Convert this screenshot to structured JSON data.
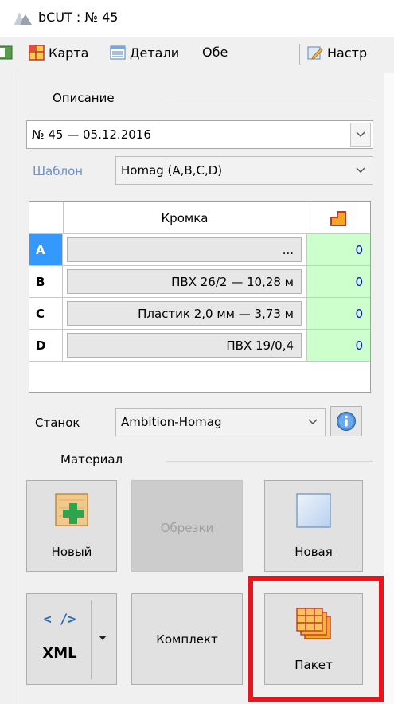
{
  "window": {
    "title": "bCUT : № 45"
  },
  "toolbar": {
    "karta_label": "Карта",
    "detali_label": "Детали",
    "obe_label": "Обе",
    "nastr_label": "Настр"
  },
  "description": {
    "group_label": "Описание",
    "value": "№ 45 — 05.12.2016"
  },
  "template": {
    "label": "Шаблон",
    "value": "Homag (A,B,C,D)"
  },
  "edge_table": {
    "column_header": "Кромка",
    "rows": [
      {
        "key": "A",
        "edge": "...",
        "value": "0"
      },
      {
        "key": "B",
        "edge": "ПВХ 26/2 — 10,28 м",
        "value": "0"
      },
      {
        "key": "C",
        "edge": "Пластик 2,0 мм — 3,73 м",
        "value": "0"
      },
      {
        "key": "D",
        "edge": "ПВХ 19/0,4",
        "value": "0"
      }
    ]
  },
  "machine": {
    "label": "Станок",
    "value": "Ambition-Homag"
  },
  "material": {
    "group_label": "Материал",
    "new_button": "Новый",
    "offcuts_button": "Обрезки",
    "new_sheet_button": "Новая"
  },
  "export": {
    "xml_top": "< />",
    "xml_bottom": "XML",
    "kit_button": "Комплект",
    "package_button": "Пакет"
  },
  "colors": {
    "active_row": "#3399ff",
    "value_cell": "#ccffcc",
    "value_text": "#0000cc",
    "template_label": "#6e92c6",
    "highlight": "#e8141e"
  }
}
